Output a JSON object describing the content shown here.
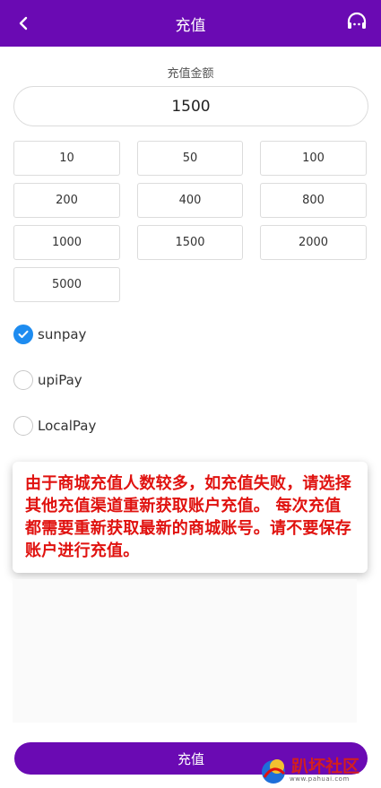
{
  "header": {
    "title": "充值"
  },
  "amount": {
    "label": "充值金额",
    "value": "1500",
    "presets": [
      "10",
      "50",
      "100",
      "200",
      "400",
      "800",
      "1000",
      "1500",
      "2000",
      "5000"
    ]
  },
  "payment_methods": [
    {
      "label": "sunpay",
      "checked": true
    },
    {
      "label": "upiPay",
      "checked": false
    },
    {
      "label": "LocalPay",
      "checked": false
    }
  ],
  "notice": "由于商城充值人数较多，如充值失败，请选择其他充值渠道重新获取账户充值。 每次充值都需要重新获取最新的商城账号。请不要保存账户进行充值。",
  "submit_label": "充值",
  "watermark": {
    "text": "趴坏社区",
    "url": "www.pahuai.com"
  },
  "colors": {
    "brand": "#6a0ab3",
    "notice_text": "#e0120f",
    "radio_checked": "#1e8cf0"
  }
}
